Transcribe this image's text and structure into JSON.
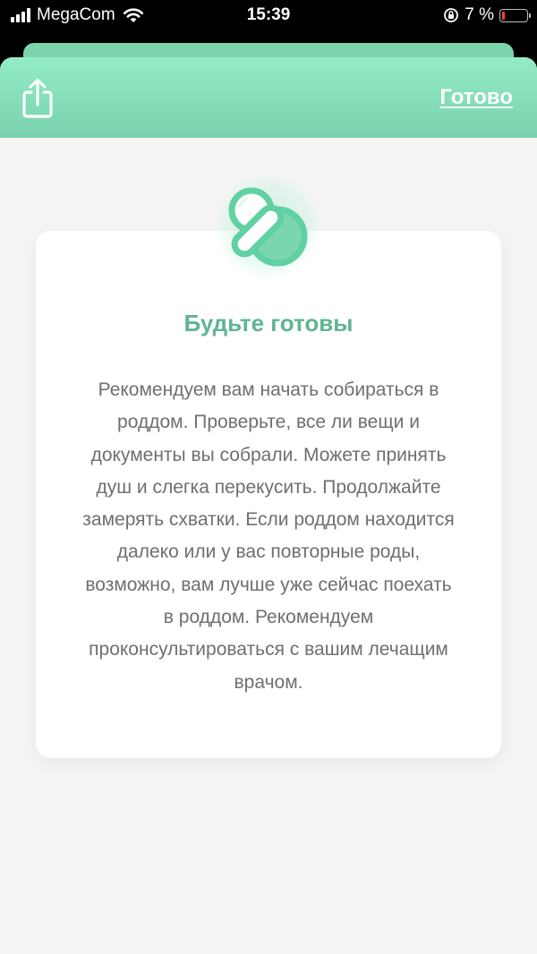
{
  "status_bar": {
    "carrier": "MegaCom",
    "time": "15:39",
    "battery": "7 %"
  },
  "header": {
    "done_label": "Готово"
  },
  "card": {
    "title": "Будьте готовы",
    "text": "Рекомендуем вам начать собираться в роддом. Проверьте, все ли вещи и документы вы собрали. Можете принять душ и слегка перекусить. Продолжайте замерять схватки. Если роддом находится далеко или у вас повторные роды, возможно, вам лучше уже сейчас поехать в роддом. Рекомендуем проконсультироваться с вашим лечащим врачом."
  },
  "icons": {
    "share": "share-icon",
    "pacifier": "pacifier-icon",
    "wifi": "wifi-icon",
    "signal": "signal-icon",
    "battery": "battery-icon",
    "rotation_lock": "rotation-lock-icon"
  },
  "colors": {
    "accent": "#79d2ad",
    "title_green": "#5fb592",
    "body_text": "#6f6f6f",
    "background": "#f4f4f4"
  }
}
